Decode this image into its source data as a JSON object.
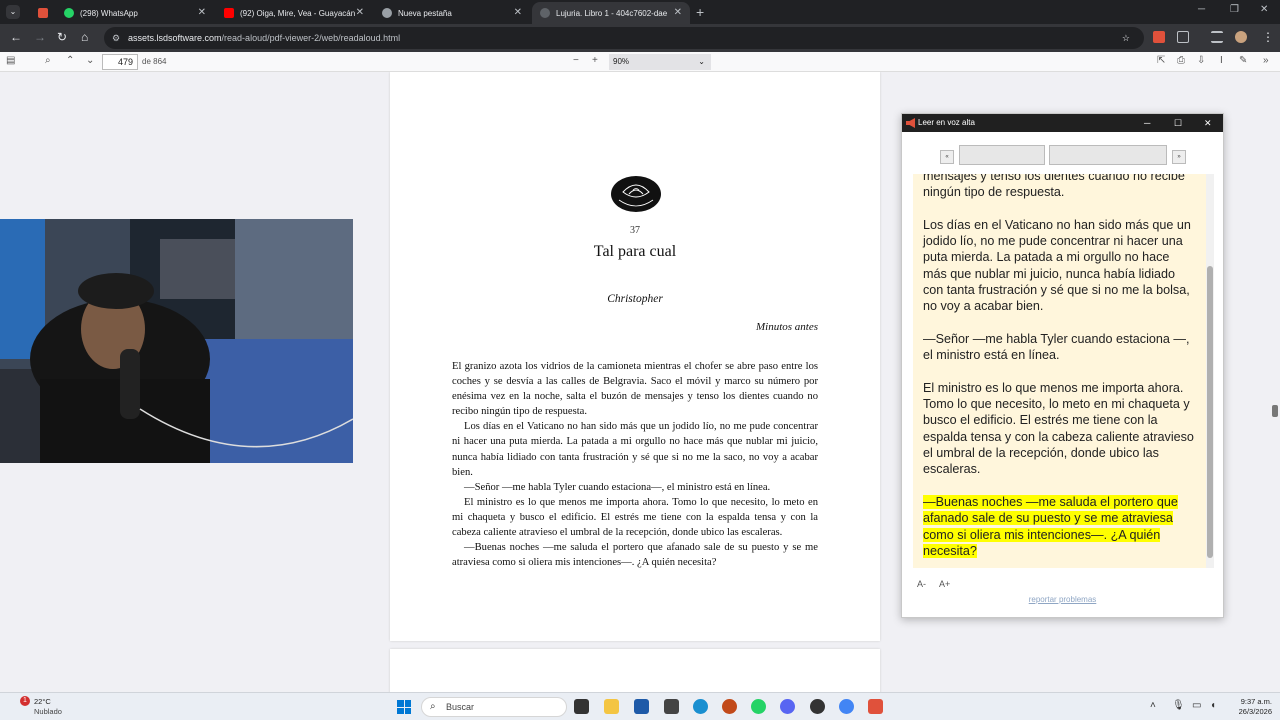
{
  "browser": {
    "tabs": [
      {
        "label": "(298) WhatsApp",
        "color": "#25d366",
        "icon": "whatsapp-icon"
      },
      {
        "label": "(92) Oiga, Mire, Vea - Guayacán",
        "color": "#ff0000",
        "icon": "youtube-icon"
      },
      {
        "label": "Nueva pestaña",
        "color": "#9aa0a6",
        "icon": "chrome-icon"
      },
      {
        "label": "Lujuria. Libro 1 - 404c7602-dae",
        "color": "#5f6368",
        "icon": "document-icon"
      }
    ],
    "url_host": "assets.lsdsoftware.com",
    "url_path": "/read-aloud/pdf-viewer-2/web/readaloud.html"
  },
  "pdf": {
    "page_number": "479",
    "page_total": "de 864",
    "zoom": "90%",
    "chapter_number": "37",
    "chapter_title": "Tal para cual",
    "pov": "Christopher",
    "time_note": "Minutos antes",
    "paragraphs": [
      "El granizo azota los vidrios de la camioneta mientras el chofer se abre paso entre los coches y se desvía a las calles de Belgravia. Saco el móvil y marco su número por enésima vez en la noche, salta el buzón de mensajes y tenso los dientes cuando no recibo ningún tipo de respuesta.",
      "Los días en el Vaticano no han sido más que un jodido lío, no me pude concentrar ni hacer una puta mierda. La patada a mi orgullo no hace más que nublar mi juicio, nunca había lidiado con tanta frustración y sé que si no me la saco, no voy a acabar bien.",
      "—Señor —me habla Tyler cuando estaciona—, el ministro está en línea.",
      "El ministro es lo que menos me importa ahora. Tomo lo que necesito, lo meto en mi chaqueta y busco el edificio. El estrés me tiene con la espalda tensa y con la cabeza caliente atravieso el umbral de la recepción, donde ubico las escaleras.",
      "—Buenas noches —me saluda el portero que afanado sale de su puesto y se me atraviesa como si oliera mis intenciones—. ¿A quién necesita?"
    ]
  },
  "read_aloud": {
    "title": "Leer en voz alta",
    "prev_label": "«",
    "next_label": "»",
    "paragraphs": [
      "mensajes y tenso los dientes cuando no recibe ningún tipo de respuesta.",
      "Los días en el Vaticano no han sido más que un jodido lío, no me pude concentrar ni hacer una puta mierda. La patada a mi orgullo no hace más que nublar mi juicio, nunca había lidiado con tanta frustración y sé que si no me la bolsa, no voy a acabar bien.",
      "—Señor —me habla Tyler cuando estaciona —, el ministro está en línea.",
      "El ministro es lo que menos me importa ahora. Tomo lo que necesito, lo meto en mi chaqueta y busco el edificio. El estrés me tiene con la espalda tensa y con la cabeza caliente atravieso el umbral de la recepción, donde ubico las escaleras."
    ],
    "highlighted": "—Buenas noches —me saluda el portero que afanado sale de su puesto y se me atraviesa como si oliera mis intenciones—. ¿A quién necesita?",
    "font_decrease": "A-",
    "font_increase": "A+",
    "report_link": "reportar problemas",
    "highlight_color": "#ffff00"
  },
  "taskbar": {
    "weather_temp": "22°C",
    "weather_desc": "Nublado",
    "weather_badge": "1",
    "search_label": "Buscar",
    "time": "9:37 a.m.",
    "date": "26/3/2026"
  }
}
